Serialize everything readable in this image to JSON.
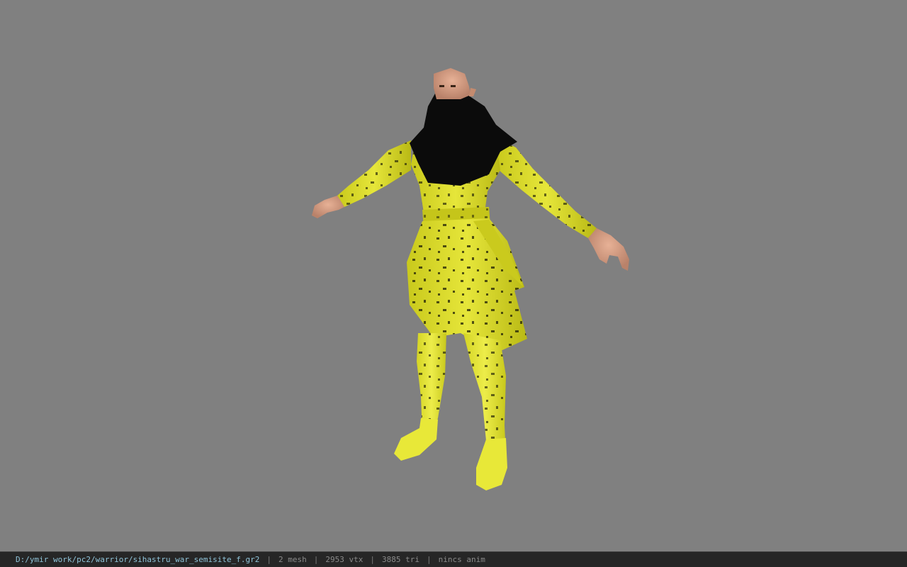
{
  "viewer": {
    "background_color": "#808080",
    "model_subject": "female warrior character in yellow armor with black scarf, T-pose",
    "colors": {
      "armor": "#d8d825",
      "scarf": "#0a0a0a",
      "skin": "#d69a7c"
    }
  },
  "status_bar": {
    "file_path": "D:/ymir work/pc2/warrior/sihastru_war_semisite_f.gr2",
    "separator": "|",
    "mesh_count": "2 mesh",
    "vertex_count": "2953 vtx",
    "triangle_count": "3885 tri",
    "animation": "nincs anim"
  }
}
